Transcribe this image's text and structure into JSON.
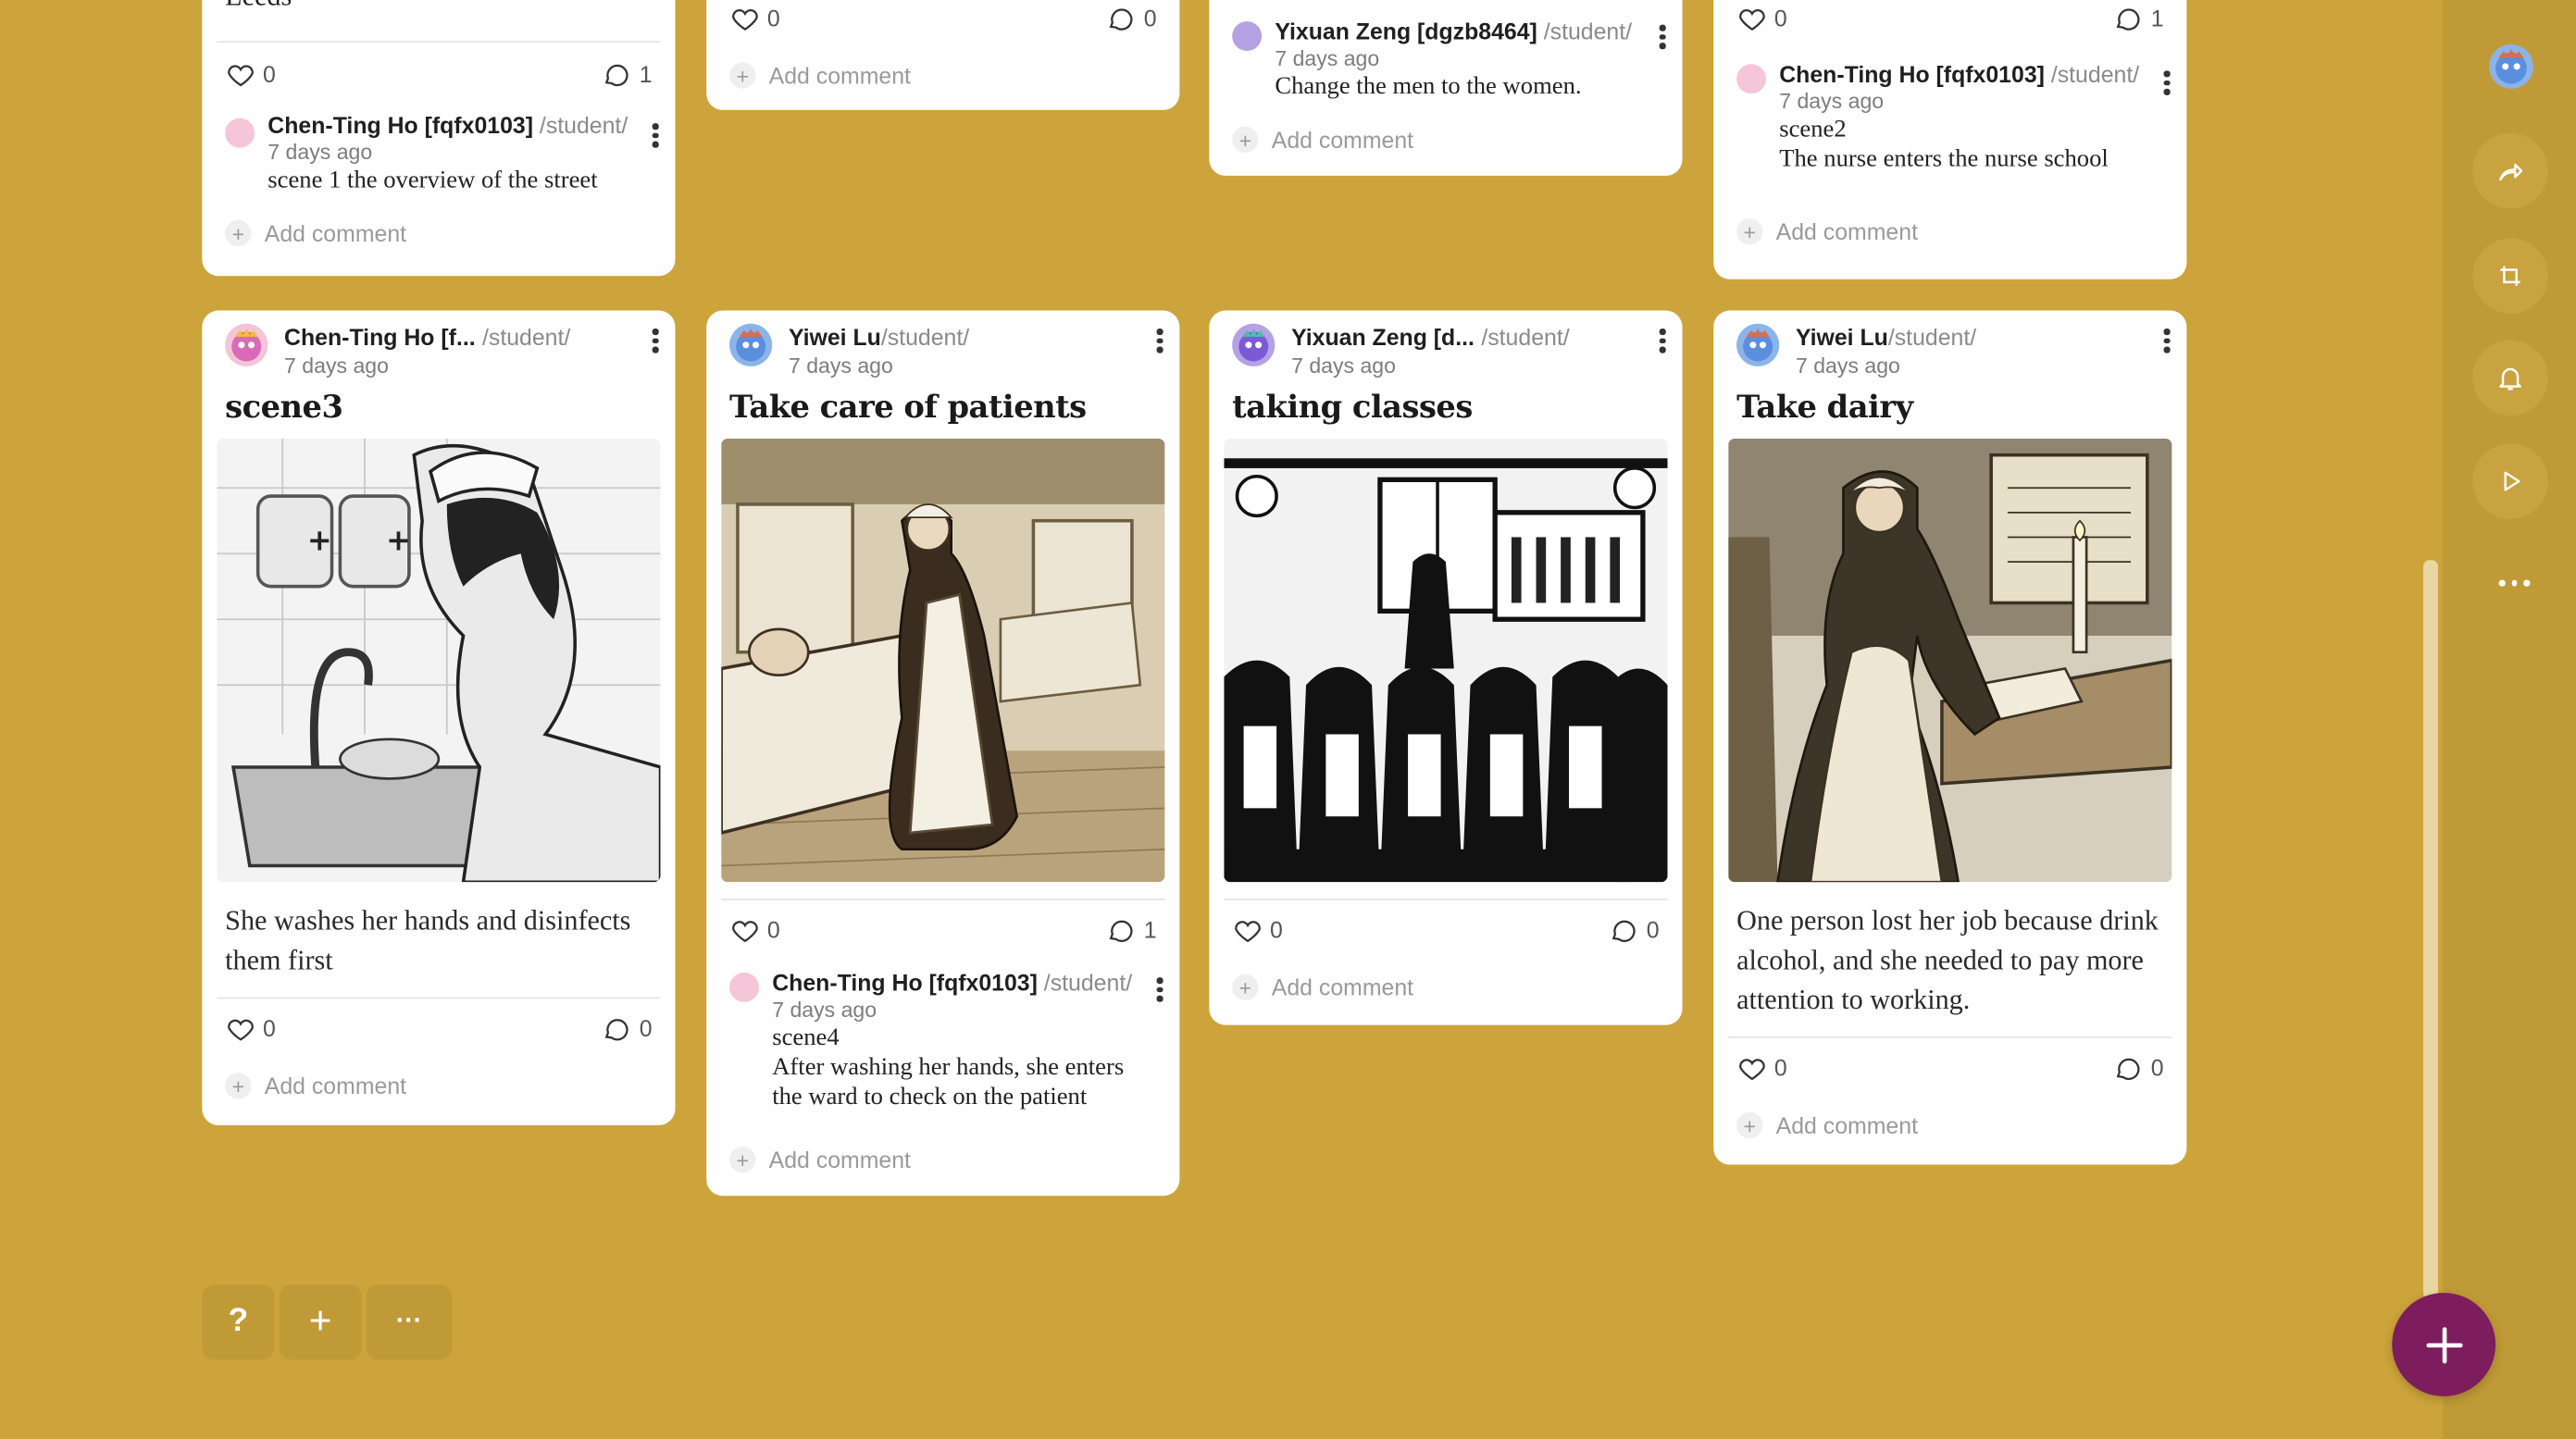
{
  "colors": {
    "background": "#cda43b",
    "toolbar": "#c09a37",
    "fab": "#7d1d5d",
    "card": "#ffffff"
  },
  "top_row": [
    {
      "partial_text": "Leeds",
      "likes": "0",
      "comments": "1",
      "comment": {
        "author": "Chen-Ting Ho [fqfx0103]",
        "path": "/student/",
        "time": "7 days ago",
        "text": "scene 1 the overview of the street"
      },
      "add_comment": "Add comment"
    },
    {
      "likes": "0",
      "comments": "0",
      "add_comment": "Add comment"
    },
    {
      "comment": {
        "author": "Yixuan Zeng [dgzb8464]",
        "path": "/student/",
        "time": "7 days ago",
        "text": "Change the men to the women."
      },
      "add_comment": "Add comment"
    },
    {
      "likes": "0",
      "comments": "1",
      "comment": {
        "author": "Chen-Ting Ho [fqfx0103]",
        "path": "/student/",
        "time": "7 days ago",
        "line1": "scene2",
        "line2": "The nurse enters the nurse school"
      },
      "add_comment": "Add comment"
    }
  ],
  "cards": [
    {
      "author": "Chen-Ting Ho [f...",
      "path": "/student/",
      "time": "7 days ago",
      "title": "scene3",
      "image": "nurse-washing-hands-illustration",
      "body": "She washes her hands and disinfects them first",
      "likes": "0",
      "comments": "0",
      "add_comment": "Add comment"
    },
    {
      "author": "Yiwei Lu",
      "path": "/student/",
      "time": "7 days ago",
      "title": "Take care of patients",
      "image": "nurse-in-hospital-ward-illustration",
      "likes": "0",
      "comments": "1",
      "comment": {
        "author": "Chen-Ting Ho [fqfx0103]",
        "path": "/student/",
        "time": "7 days ago",
        "line1": "scene4",
        "line2": "After washing her hands, she enters the ward to check on the patient"
      },
      "add_comment": "Add comment"
    },
    {
      "author": "Yixuan Zeng [d...",
      "path": "/student/",
      "time": "7 days ago",
      "title": "taking classes",
      "image": "nurses-in-classroom-illustration",
      "likes": "0",
      "comments": "0",
      "add_comment": "Add comment"
    },
    {
      "author": "Yiwei Lu",
      "path": "/student/",
      "time": "7 days ago",
      "title": "Take dairy",
      "image": "nurse-writing-diary-illustration",
      "body": "One person lost her job because drink alcohol, and she needed to pay more attention to working.",
      "likes": "0",
      "comments": "0",
      "add_comment": "Add comment"
    }
  ],
  "toolbar": {
    "items": [
      "user-avatar",
      "share-icon",
      "remake-icon",
      "bell-icon",
      "play-icon",
      "more-icon"
    ]
  },
  "bottom": {
    "help": "?",
    "add": "+",
    "more": "···"
  }
}
